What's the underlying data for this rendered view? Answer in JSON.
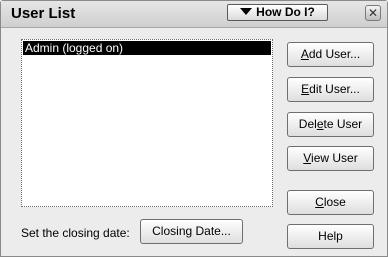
{
  "window": {
    "title": "User List",
    "help_menu_label": "How Do I?",
    "close_glyph": "✕"
  },
  "users": {
    "items": [
      "Admin (logged on)"
    ],
    "selected_index": 0
  },
  "actions": {
    "add_user": {
      "before": "",
      "key": "A",
      "after": "dd User..."
    },
    "edit_user": {
      "before": "",
      "key": "E",
      "after": "dit User..."
    },
    "delete_user": {
      "before": "Del",
      "key": "e",
      "after": "te User"
    },
    "view_user": {
      "before": "",
      "key": "V",
      "after": "iew User"
    },
    "close": {
      "before": "",
      "key": "C",
      "after": "lose"
    },
    "help": "Help"
  },
  "closing_date": {
    "label": "Set the closing date:",
    "button_label": "Closing Date..."
  },
  "colors": {
    "selection_bg": "#000000",
    "selection_fg": "#ffffff",
    "window_bg": "#ececec"
  }
}
